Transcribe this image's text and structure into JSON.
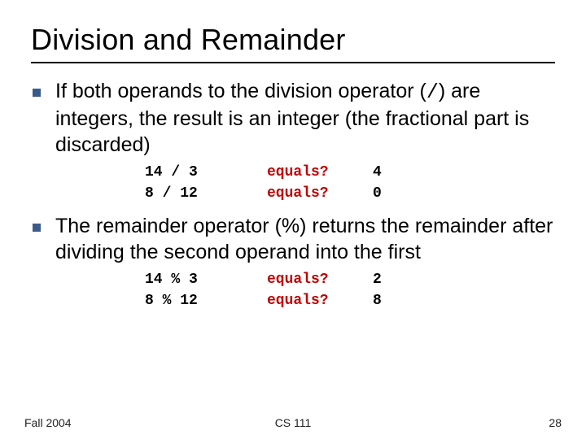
{
  "title": "Division and Remainder",
  "bullets": {
    "b1_pre": "If both operands to the division operator (",
    "b1_op": "/",
    "b1_post": ") are integers, the result is an integer (the fractional part is discarded)",
    "b2": "The remainder operator (%) returns the remainder after dividing the second operand into the first"
  },
  "examples1": [
    {
      "expr": "14 / 3",
      "eq": "equals?",
      "ans": "4"
    },
    {
      "expr": "8 / 12",
      "eq": "equals?",
      "ans": "0"
    }
  ],
  "examples2": [
    {
      "expr": "14 % 3",
      "eq": "equals?",
      "ans": "2"
    },
    {
      "expr": "8 % 12",
      "eq": "equals?",
      "ans": "8"
    }
  ],
  "footer": {
    "left": "Fall 2004",
    "center": "CS 111",
    "right": "28"
  }
}
